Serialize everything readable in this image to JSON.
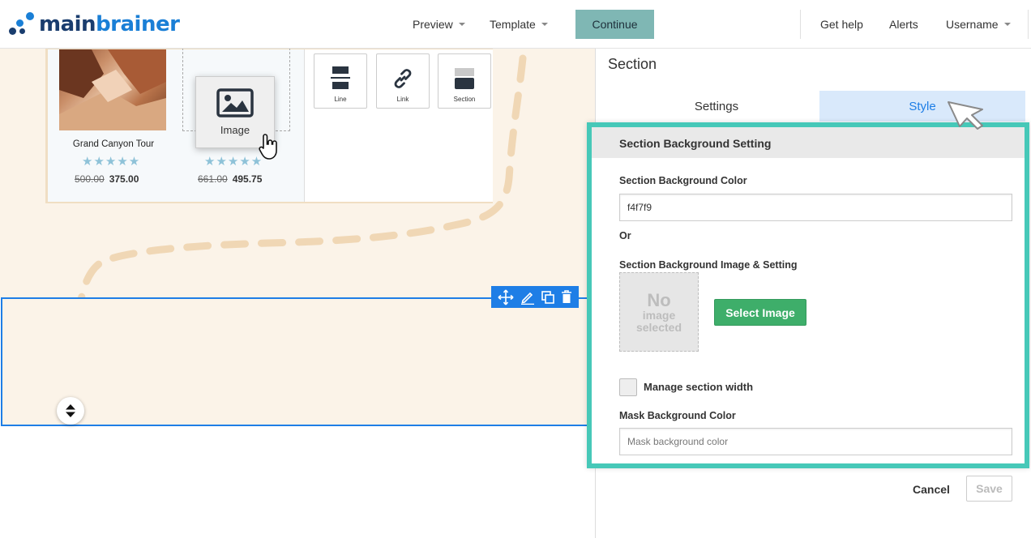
{
  "app": {
    "logo_main": "main",
    "logo_brainer": "brainer"
  },
  "header": {
    "preview_label": "Preview",
    "template_label": "Template",
    "continue_label": "Continue",
    "help_label": "Get help",
    "alerts_label": "Alerts",
    "username_label": "Username"
  },
  "canvas": {
    "products": [
      {
        "name": "Grand Canyon Tour",
        "stars": "★★★★★",
        "old_price": "500.00",
        "price": "375.00"
      },
      {
        "name": "",
        "stars": "★★★★★",
        "old_price": "661.00",
        "price": "495.75"
      }
    ],
    "drag_item_label": "Image",
    "blocks": [
      {
        "label": "Line",
        "icon": "line-icon"
      },
      {
        "label": "Link",
        "icon": "link-icon"
      },
      {
        "label": "Section",
        "icon": "section-icon"
      }
    ]
  },
  "panel": {
    "title": "Section",
    "tabs": [
      {
        "label": "Settings",
        "active": false
      },
      {
        "label": "Style",
        "active": true
      }
    ],
    "group_title": "Section Background Setting",
    "bg_color_label": "Section Background Color",
    "bg_color_value": "f4f7f9",
    "or_label": "Or",
    "bg_image_label": "Section Background Image & Setting",
    "no_image_big": "No",
    "no_image_line2": "image",
    "no_image_line3": "selected",
    "select_image_label": "Select Image",
    "manage_width_label": "Manage section width",
    "mask_color_label": "Mask Background Color",
    "mask_color_placeholder": "Mask background color",
    "cancel_label": "Cancel",
    "save_label": "Save"
  },
  "colors": {
    "accent_blue": "#1e7ee6",
    "highlight_teal": "#46c8b8",
    "continue_bg": "#7fb7b4",
    "select_green": "#3eae6a",
    "cream": "#fbf3e8"
  }
}
